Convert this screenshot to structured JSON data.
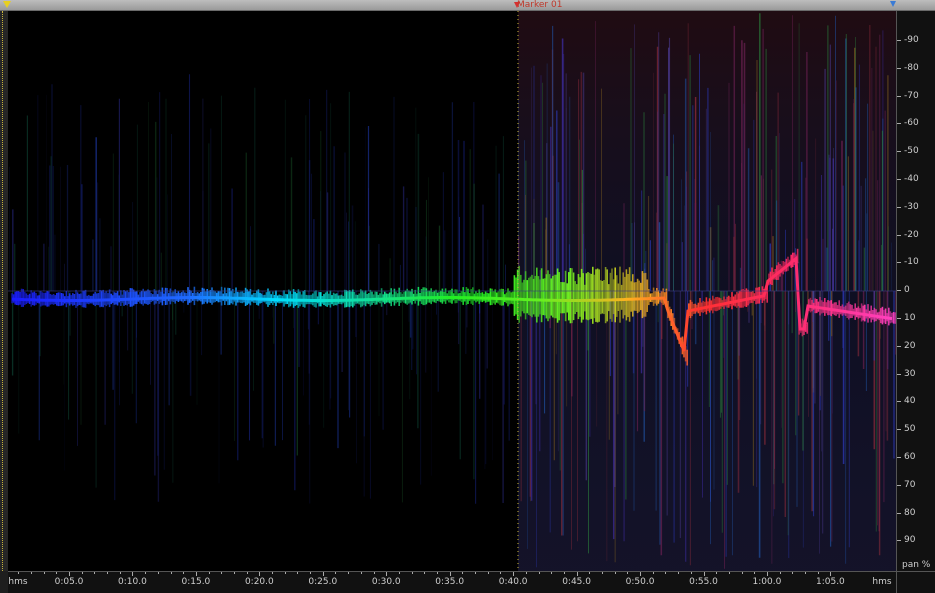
{
  "marker": {
    "label": "Marker 01"
  },
  "time_ruler": {
    "start_unit": "hms",
    "end_unit": "hms",
    "ticks": [
      "0:05.0",
      "0:10.0",
      "0:15.0",
      "0:20.0",
      "0:25.0",
      "0:30.0",
      "0:35.0",
      "0:40.0",
      "0:45.0",
      "0:50.0",
      "0:55.0",
      "1:00.0",
      "1:05.0"
    ]
  },
  "pan_ruler": {
    "unit": "pan %",
    "ticks": [
      "-90",
      "-80",
      "-70",
      "-60",
      "-50",
      "-40",
      "-30",
      "-20",
      "-10",
      "0",
      "10",
      "20",
      "30",
      "40",
      "50",
      "60",
      "70",
      "80",
      "90"
    ]
  },
  "colors": {
    "background": "#000000",
    "marker": "#d63030",
    "start_flag": "#e8d020",
    "end_flag": "#3a7bd5"
  }
}
